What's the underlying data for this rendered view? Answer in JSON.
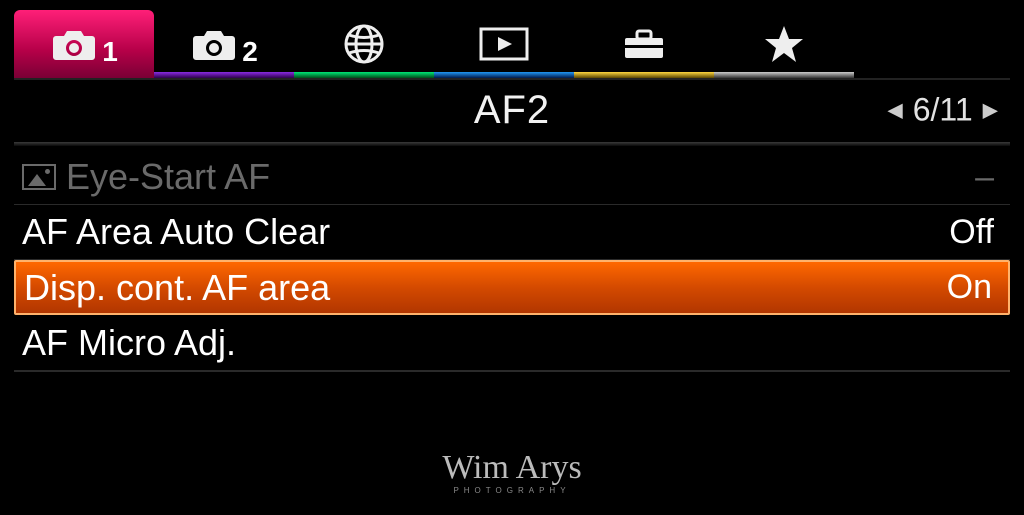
{
  "tabs": [
    {
      "name": "camera-1",
      "badge": "1"
    },
    {
      "name": "camera-2",
      "badge": "2"
    },
    {
      "name": "network"
    },
    {
      "name": "playback"
    },
    {
      "name": "toolbox"
    },
    {
      "name": "favorites"
    }
  ],
  "header": {
    "title": "AF2",
    "page_indicator": "6/11"
  },
  "menu": [
    {
      "label": "Eye-Start AF",
      "value": "–",
      "disabled": true,
      "has_icon": true
    },
    {
      "label": "AF Area Auto Clear",
      "value": "Off"
    },
    {
      "label": "Disp. cont. AF area",
      "value": "On",
      "selected": true
    },
    {
      "label": "AF Micro Adj.",
      "value": ""
    }
  ],
  "watermark": {
    "main": "Wim Arys",
    "sub": "PHOTOGRAPHY"
  }
}
